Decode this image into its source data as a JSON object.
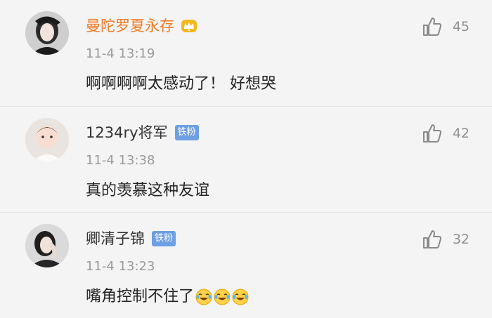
{
  "comments": [
    {
      "username": "曼陀罗夏永存",
      "time": "11-4 13:19",
      "text": "啊啊啊啊太感动了！ 好想哭",
      "likes": "45",
      "badge": "",
      "avatar_icon": "avatar-woman-dark-hair",
      "name_color": "#f07c27"
    },
    {
      "username": "1234ry将军",
      "time": "11-4 13:38",
      "text": "真的羡慕这种友谊",
      "likes": "42",
      "badge": "铁粉",
      "avatar_icon": "avatar-baby"
    },
    {
      "username": "卿清子锦",
      "time": "11-4 13:23",
      "text": "嘴角控制不住了",
      "likes": "32",
      "badge": "铁粉",
      "avatar_icon": "avatar-woman-hand-on-face",
      "text_emojis": [
        "laugh-cry-emoji",
        "laugh-cry-emoji",
        "laugh-cry-emoji"
      ]
    }
  ],
  "colors": {
    "background": "#f4f4f4",
    "vip_name": "#f07c27",
    "badge_bg": "#6e9fe3",
    "time": "#9a9a9a",
    "like_count": "#8f8f8f"
  }
}
